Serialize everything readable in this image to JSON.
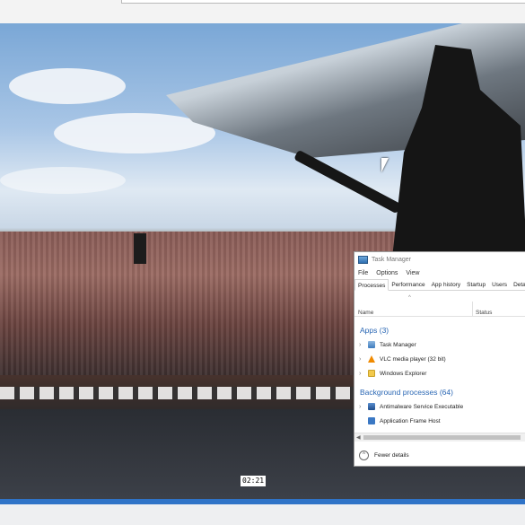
{
  "video": {
    "timestamp": "02:21"
  },
  "task_manager": {
    "title": "Task Manager",
    "menu": [
      "File",
      "Options",
      "View"
    ],
    "tabs": [
      "Processes",
      "Performance",
      "App history",
      "Startup",
      "Users",
      "Deta"
    ],
    "active_tab": "Processes",
    "columns": {
      "name": "Name",
      "status": "Status"
    },
    "groups": {
      "apps": {
        "heading": "Apps (3)",
        "items": [
          "Task Manager",
          "VLC media player (32 bit)",
          "Windows Explorer"
        ]
      },
      "background": {
        "heading": "Background processes (64)",
        "items": [
          "Antimalware Service Executable",
          "Application Frame Host"
        ]
      }
    },
    "footer": {
      "fewer_details": "Fewer details"
    },
    "icons": {
      "task_manager": "task-manager-icon",
      "vlc": "vlc-cone-icon",
      "explorer": "folder-icon",
      "antimalware": "shield-icon",
      "frame_host": "window-icon"
    }
  },
  "colors": {
    "accent": "#2a67b4",
    "seek_bar": "#2f73c7"
  }
}
